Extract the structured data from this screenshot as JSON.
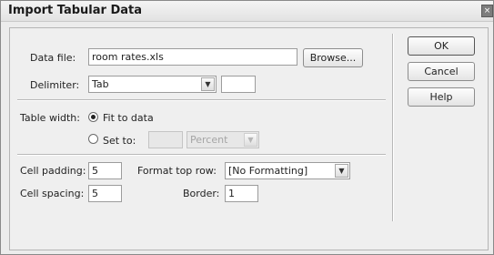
{
  "window": {
    "title": "Import Tabular Data",
    "close_glyph": "×"
  },
  "data_file": {
    "label": "Data file:",
    "value": "room rates.xls",
    "browse_label": "Browse..."
  },
  "delimiter": {
    "label": "Delimiter:",
    "value": "Tab",
    "other_value": ""
  },
  "table_width": {
    "label": "Table width:",
    "fit_label": "Fit to data",
    "set_label": "Set to:",
    "set_value": "",
    "unit_value": "Percent",
    "selected": "fit"
  },
  "cell_padding": {
    "label": "Cell padding:",
    "value": "5"
  },
  "cell_spacing": {
    "label": "Cell spacing:",
    "value": "5"
  },
  "format_top_row": {
    "label": "Format top row:",
    "value": "[No Formatting]"
  },
  "border": {
    "label": "Border:",
    "value": "1"
  },
  "buttons": {
    "ok": "OK",
    "cancel": "Cancel",
    "help": "Help"
  }
}
